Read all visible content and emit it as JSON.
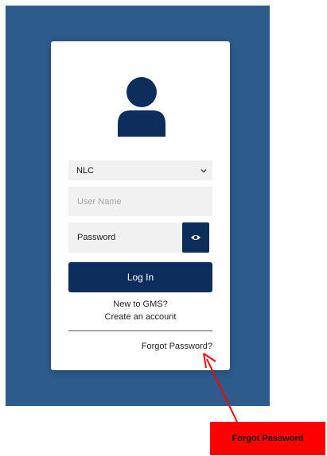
{
  "login": {
    "organization_select": {
      "selected": "NLC"
    },
    "username": {
      "placeholder": "User Name"
    },
    "password": {
      "value": "Password"
    },
    "login_label": "Log In",
    "new_to_text": "New to GMS?",
    "create_account_label": "Create an account",
    "forgot_password_label": "Forgot Password?"
  },
  "icons": {
    "avatar": "user-avatar-icon",
    "select": "chevron-down-icon",
    "password_toggle": "eye-icon"
  },
  "annotation": {
    "callout_text": "Forgot Password"
  },
  "colors": {
    "backdrop": "#2c5b8c",
    "primary": "#0d2d5c",
    "callout": "#ff0000"
  }
}
